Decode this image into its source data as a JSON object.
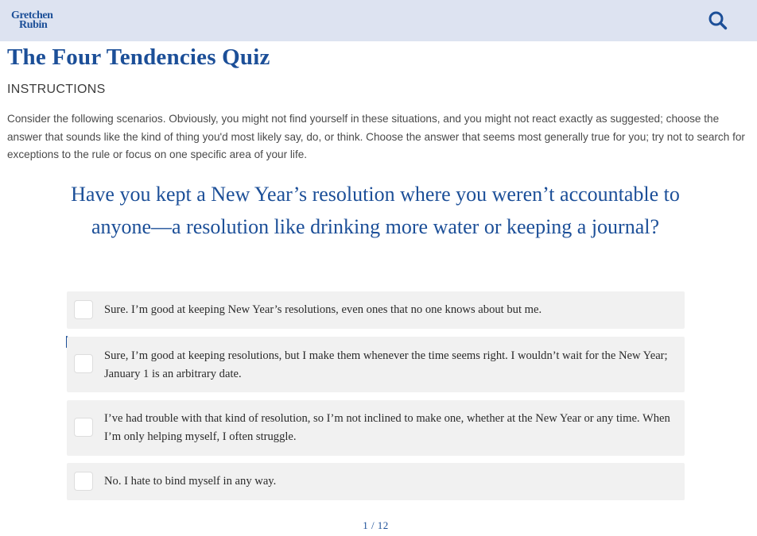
{
  "header": {
    "logo_line1": "Gretchen",
    "logo_line2": "Rubin",
    "search_icon": "search-icon"
  },
  "page": {
    "title": "The Four Tendencies Quiz",
    "instructions_heading": "INSTRUCTIONS",
    "instructions_text": "Consider the following scenarios. Obviously, you might not find yourself in these situations, and you might not react exactly as suggested; choose the answer that sounds like the kind of thing you'd most likely say, do, or think. Choose the answer that seems most generally true for you; try not to search for exceptions to the rule or focus on one specific area of your life."
  },
  "quiz": {
    "question": "Have you kept a New Year’s resolution where you weren’t accountable to anyone—a resolution like drinking more water or keeping a journal?",
    "options": [
      {
        "label": "Sure. I’m good at keeping New Year’s resolutions, even ones that no one knows about but me.",
        "checked": false
      },
      {
        "label": "Sure, I’m good at keeping resolutions, but I make them whenever the time seems right. I wouldn’t wait for the New Year; January 1 is an arbitrary date.",
        "checked": false
      },
      {
        "label": "I’ve had trouble with that kind of resolution, so I’m not inclined to make one, whether at the New Year or any time. When I’m only helping myself, I often struggle.",
        "checked": false
      },
      {
        "label": "No. I hate to bind myself in any way.",
        "checked": false
      }
    ],
    "pagination": "1 / 12"
  },
  "colors": {
    "header_bg": "#dde3f1",
    "brand_blue": "#1c4f98",
    "option_bg": "#f1f1f1"
  }
}
